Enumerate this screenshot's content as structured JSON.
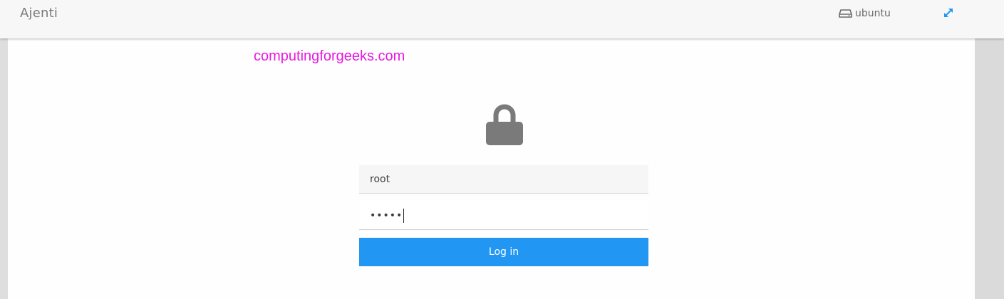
{
  "header": {
    "brand": "Ajenti",
    "hostname": "ubuntu",
    "hostname_icon": "server-drive-icon",
    "expand_icon": "expand-arrows-icon",
    "accent_color": "#2196f3"
  },
  "watermark": {
    "text": "computingforgeeks.com",
    "color": "#e51ae0"
  },
  "login": {
    "lock_icon": "lock-icon",
    "username_value": "root",
    "password_mask": "•••••",
    "button_label": "Log in",
    "button_color": "#2196f3"
  }
}
